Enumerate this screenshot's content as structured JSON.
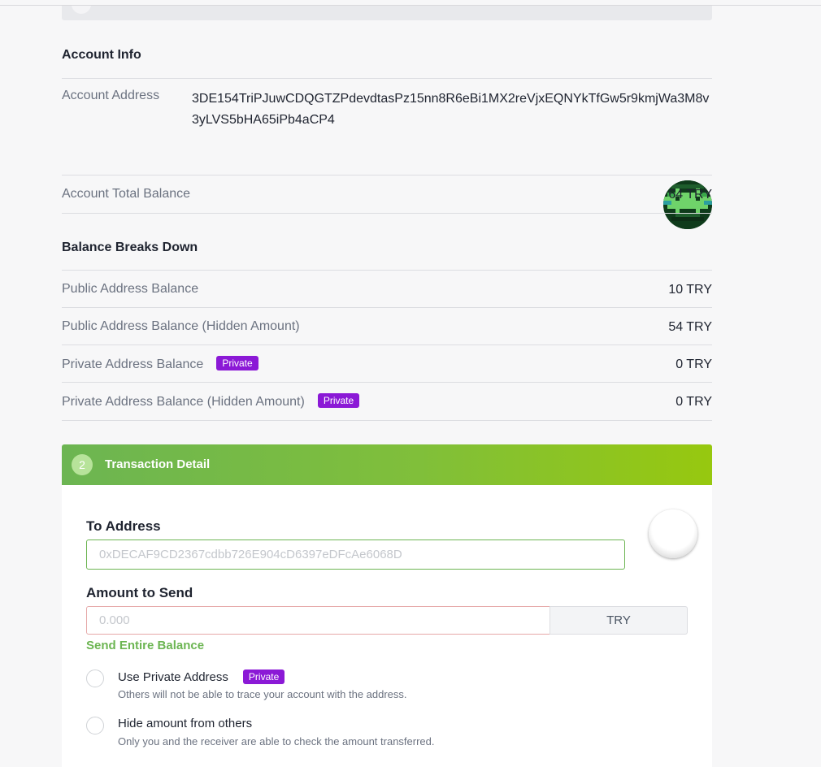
{
  "account_info": {
    "heading": "Account Info",
    "address_label": "Account Address",
    "address_value": "3DE154TriPJuwCDQGTZPdevdtasPz15nn8R6eBi1MX2reVjxEQNYkTfGw5r9kmjWa3M8v3yLVS5bHA65iPb4aCP4",
    "total_label": "Account Total Balance",
    "total_value": "64 TRY"
  },
  "breakdown": {
    "heading": "Balance Breaks Down",
    "rows": [
      {
        "label": "Public Address Balance",
        "value": "10 TRY",
        "badge": ""
      },
      {
        "label": "Public Address Balance (Hidden Amount)",
        "value": "54 TRY",
        "badge": ""
      },
      {
        "label": "Private Address Balance",
        "value": "0 TRY",
        "badge": "Private"
      },
      {
        "label": "Private Address Balance (Hidden Amount)",
        "value": "0 TRY",
        "badge": "Private"
      }
    ]
  },
  "transaction": {
    "step_number": "2",
    "heading": "Transaction Detail",
    "to_label": "To Address",
    "to_placeholder": "0xDECAF9CD2367cdbb726E904cD6397eDFcAe6068D",
    "amount_label": "Amount to Send",
    "amount_placeholder": "0.000",
    "unit": "TRY",
    "send_all": "Send Entire Balance",
    "options": [
      {
        "title": "Use Private Address",
        "badge": "Private",
        "desc": "Others will not be able to trace your account with the address."
      },
      {
        "title": "Hide amount from others",
        "badge": "",
        "desc": "Only you and the receiver are able to check the amount transferred."
      }
    ]
  },
  "colors": {
    "accent_green": "#6cb552",
    "private_badge": "#8b19d6"
  }
}
